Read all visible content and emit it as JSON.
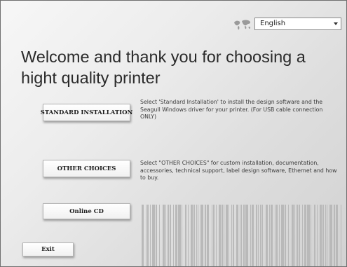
{
  "language": {
    "selected": "English"
  },
  "headline": "Welcome and thank you for choosing a hight quality printer",
  "buttons": {
    "standard": "STANDARD INSTALLATION",
    "other": "OTHER CHOICES",
    "online": "Online CD",
    "exit": "Exit"
  },
  "descriptions": {
    "standard": "Select 'Standard Installation' to install the design software and the Seagull Windows driver for your printer. (For USB cable connection ONLY)",
    "other": "Select \"OTHER CHOICES\" for custom installation, documentation, accessories, technical support, label design software, Ethernet and how to buy."
  },
  "colors": {
    "background": "#e4e4e4",
    "text": "#2a2a2a",
    "barcode": "#b9b9b9"
  },
  "icons": {
    "language": "globe-icon",
    "dropdown": "chevron-down-icon",
    "decoration": "barcode"
  }
}
